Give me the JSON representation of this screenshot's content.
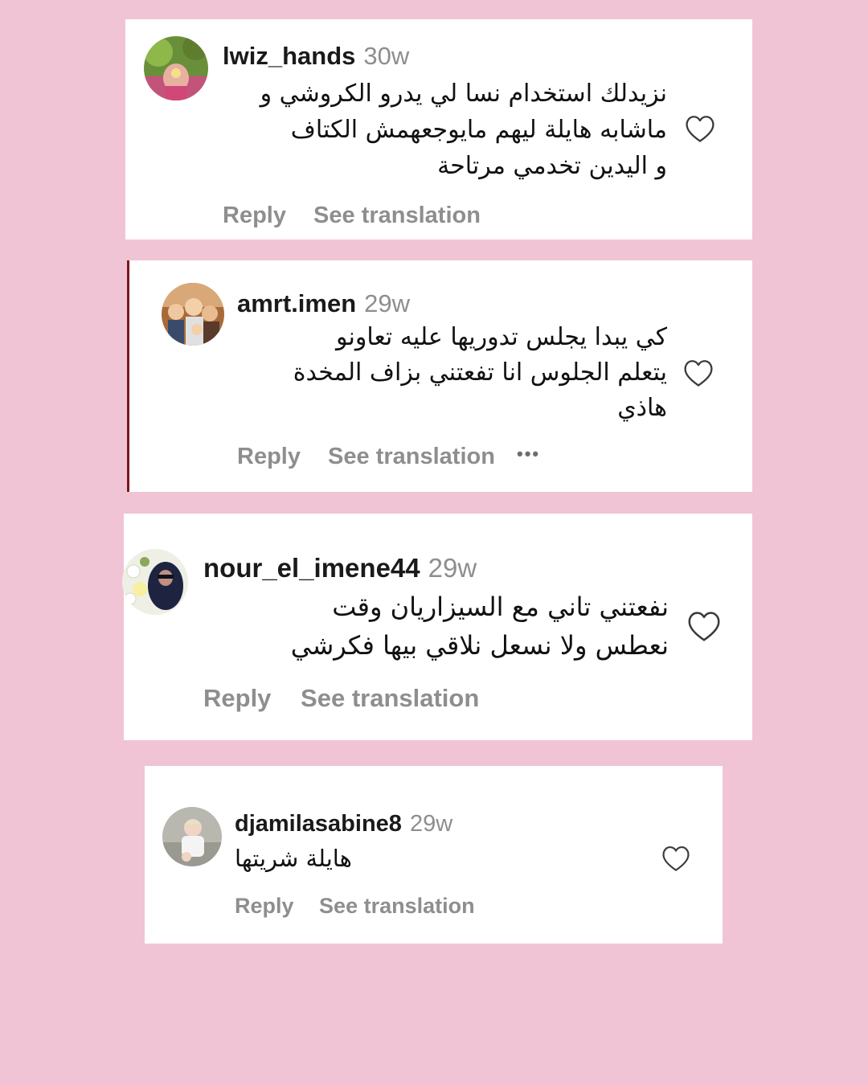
{
  "comments": [
    {
      "username": "lwiz_hands",
      "time": "30w",
      "lines": [
        "نزيدلك استخدام نسا لي يدرو الكروشي و",
        "ماشابه هايلة ليهم مايوجعهمش الكتاف",
        "و اليدين تخدمي مرتاحة"
      ],
      "reply_label": "Reply",
      "translate_label": "See translation"
    },
    {
      "username": "amrt.imen",
      "time": "29w",
      "lines": [
        "كي يبدا يجلس تدوريها عليه تعاونو",
        "يتعلم الجلوس انا تفعتني بزاف المخدة",
        "هاذي"
      ],
      "reply_label": "Reply",
      "translate_label": "See translation",
      "more_label": "•••"
    },
    {
      "username": "nour_el_imene44",
      "time": "29w",
      "lines": [
        "نفعتني تاني مع السيزاريان وقت",
        "نعطس ولا نسعل نلاقي بيها فكرشي"
      ],
      "reply_label": "Reply",
      "translate_label": "See translation"
    },
    {
      "username": "djamilasabine8",
      "time": "29w",
      "lines": [
        "هايلة شريتها"
      ],
      "reply_label": "Reply",
      "translate_label": "See translation"
    }
  ],
  "icons": {
    "like": "heart-outline-icon",
    "more": "more-dots-icon"
  },
  "colors": {
    "background": "#f0c4d4",
    "card": "#ffffff",
    "username": "#1a1a1a",
    "muted": "#8e8e8e"
  }
}
